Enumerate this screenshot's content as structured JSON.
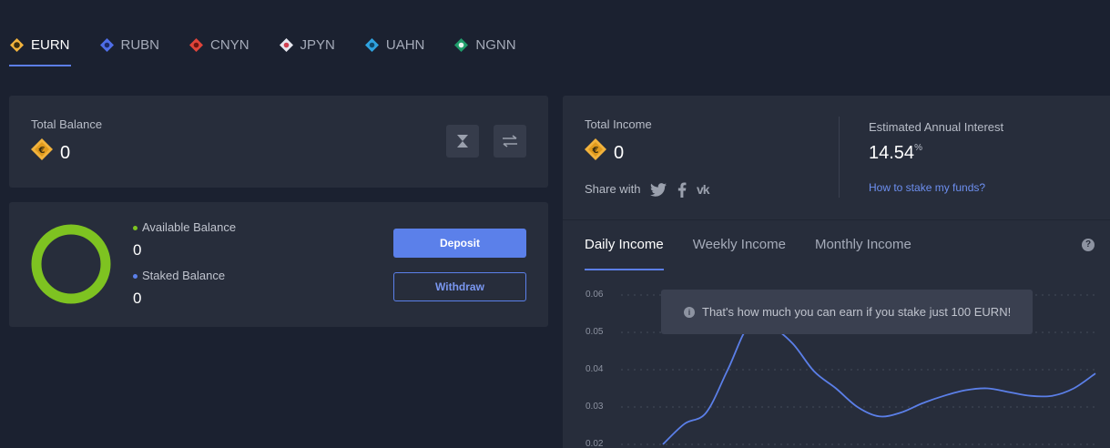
{
  "tabs": [
    {
      "label": "EURN",
      "icon": "eurn-coin-icon",
      "color": "#f2b33d",
      "active": true
    },
    {
      "label": "RUBN",
      "icon": "rubn-coin-icon",
      "color": "#4f6ee8",
      "active": false
    },
    {
      "label": "CNYN",
      "icon": "cnyn-coin-icon",
      "color": "#e0443a",
      "active": false
    },
    {
      "label": "JPYN",
      "icon": "jpyn-coin-icon",
      "color": "#e6e6ee",
      "active": false
    },
    {
      "label": "UAHN",
      "icon": "uahn-coin-icon",
      "color": "#2fa3e0",
      "active": false
    },
    {
      "label": "NGNN",
      "icon": "ngnn-coin-icon",
      "color": "#1f9c6a",
      "active": false
    }
  ],
  "total_balance": {
    "label": "Total Balance",
    "value": "0"
  },
  "balances": {
    "available_label": "Available Balance",
    "available_value": "0",
    "available_color": "#7ec321",
    "staked_label": "Staked Balance",
    "staked_value": "0",
    "staked_color": "#5b80ea",
    "deposit": "Deposit",
    "withdraw": "Withdraw"
  },
  "income": {
    "total_label": "Total Income",
    "total_value": "0",
    "share_label": "Share with",
    "share_icons": [
      "twitter-icon",
      "facebook-icon",
      "vk-icon"
    ],
    "interest_label": "Estimated Annual Interest",
    "interest_value": "14.54",
    "interest_unit": "%",
    "how_link": "How to stake my funds?"
  },
  "income_tabs": [
    "Daily Income",
    "Weekly Income",
    "Monthly Income"
  ],
  "tooltip": "That's how much you can earn if you stake just 100 EURN!",
  "chart_data": {
    "type": "line",
    "y_ticks": [
      "0.06",
      "0.05",
      "0.04",
      "0.03",
      "0.02"
    ],
    "ylim": [
      0.02,
      0.06
    ],
    "grid": true,
    "series": [
      {
        "color": "#5b7fe8",
        "points": [
          [
            0,
            0.02
          ],
          [
            1,
            0.0255
          ],
          [
            2,
            0.0285
          ],
          [
            3,
            0.04
          ],
          [
            4,
            0.052
          ],
          [
            5,
            0.0515
          ],
          [
            6,
            0.047
          ],
          [
            7,
            0.0395
          ],
          [
            8,
            0.035
          ],
          [
            9,
            0.03
          ],
          [
            10,
            0.0275
          ],
          [
            11,
            0.0285
          ],
          [
            12,
            0.031
          ],
          [
            13,
            0.033
          ],
          [
            14,
            0.0345
          ],
          [
            15,
            0.035
          ],
          [
            16,
            0.034
          ],
          [
            17,
            0.033
          ],
          [
            18,
            0.033
          ],
          [
            19,
            0.035
          ],
          [
            20,
            0.039
          ]
        ]
      }
    ]
  }
}
